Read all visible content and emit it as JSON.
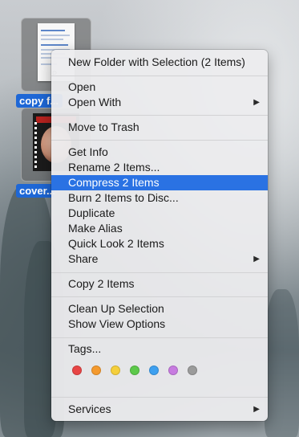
{
  "desktop": {
    "items": [
      {
        "label": "copy f..."
      },
      {
        "label": "cover..."
      }
    ],
    "doc_glyph": "P"
  },
  "menu": {
    "sections": [
      {
        "items": [
          {
            "label": "New Folder with Selection (2 Items)"
          }
        ]
      },
      {
        "items": [
          {
            "label": "Open"
          },
          {
            "label": "Open With",
            "submenu": true
          }
        ]
      },
      {
        "items": [
          {
            "label": "Move to Trash"
          }
        ]
      },
      {
        "items": [
          {
            "label": "Get Info"
          },
          {
            "label": "Rename 2 Items..."
          },
          {
            "label": "Compress 2 Items",
            "highlighted": true
          },
          {
            "label": "Burn 2 Items to Disc..."
          },
          {
            "label": "Duplicate"
          },
          {
            "label": "Make Alias"
          },
          {
            "label": "Quick Look 2 Items"
          },
          {
            "label": "Share",
            "submenu": true
          }
        ]
      },
      {
        "items": [
          {
            "label": "Copy 2 Items"
          }
        ]
      },
      {
        "items": [
          {
            "label": "Clean Up Selection"
          },
          {
            "label": "Show View Options"
          }
        ]
      },
      {
        "items": [
          {
            "label": "Tags..."
          }
        ]
      },
      {
        "items": [
          {
            "label": "Services",
            "submenu": true
          }
        ]
      }
    ],
    "submenu_glyph": "▶",
    "tag_colors": [
      {
        "name": "red",
        "color": "#e84545"
      },
      {
        "name": "orange",
        "color": "#f49a2e"
      },
      {
        "name": "yellow",
        "color": "#f5cf3b"
      },
      {
        "name": "green",
        "color": "#5cc94a"
      },
      {
        "name": "blue",
        "color": "#3ea0f0"
      },
      {
        "name": "purple",
        "color": "#c77be0"
      },
      {
        "name": "gray",
        "color": "#9b9b9b"
      }
    ],
    "highlight_color": "#2a72e3"
  }
}
